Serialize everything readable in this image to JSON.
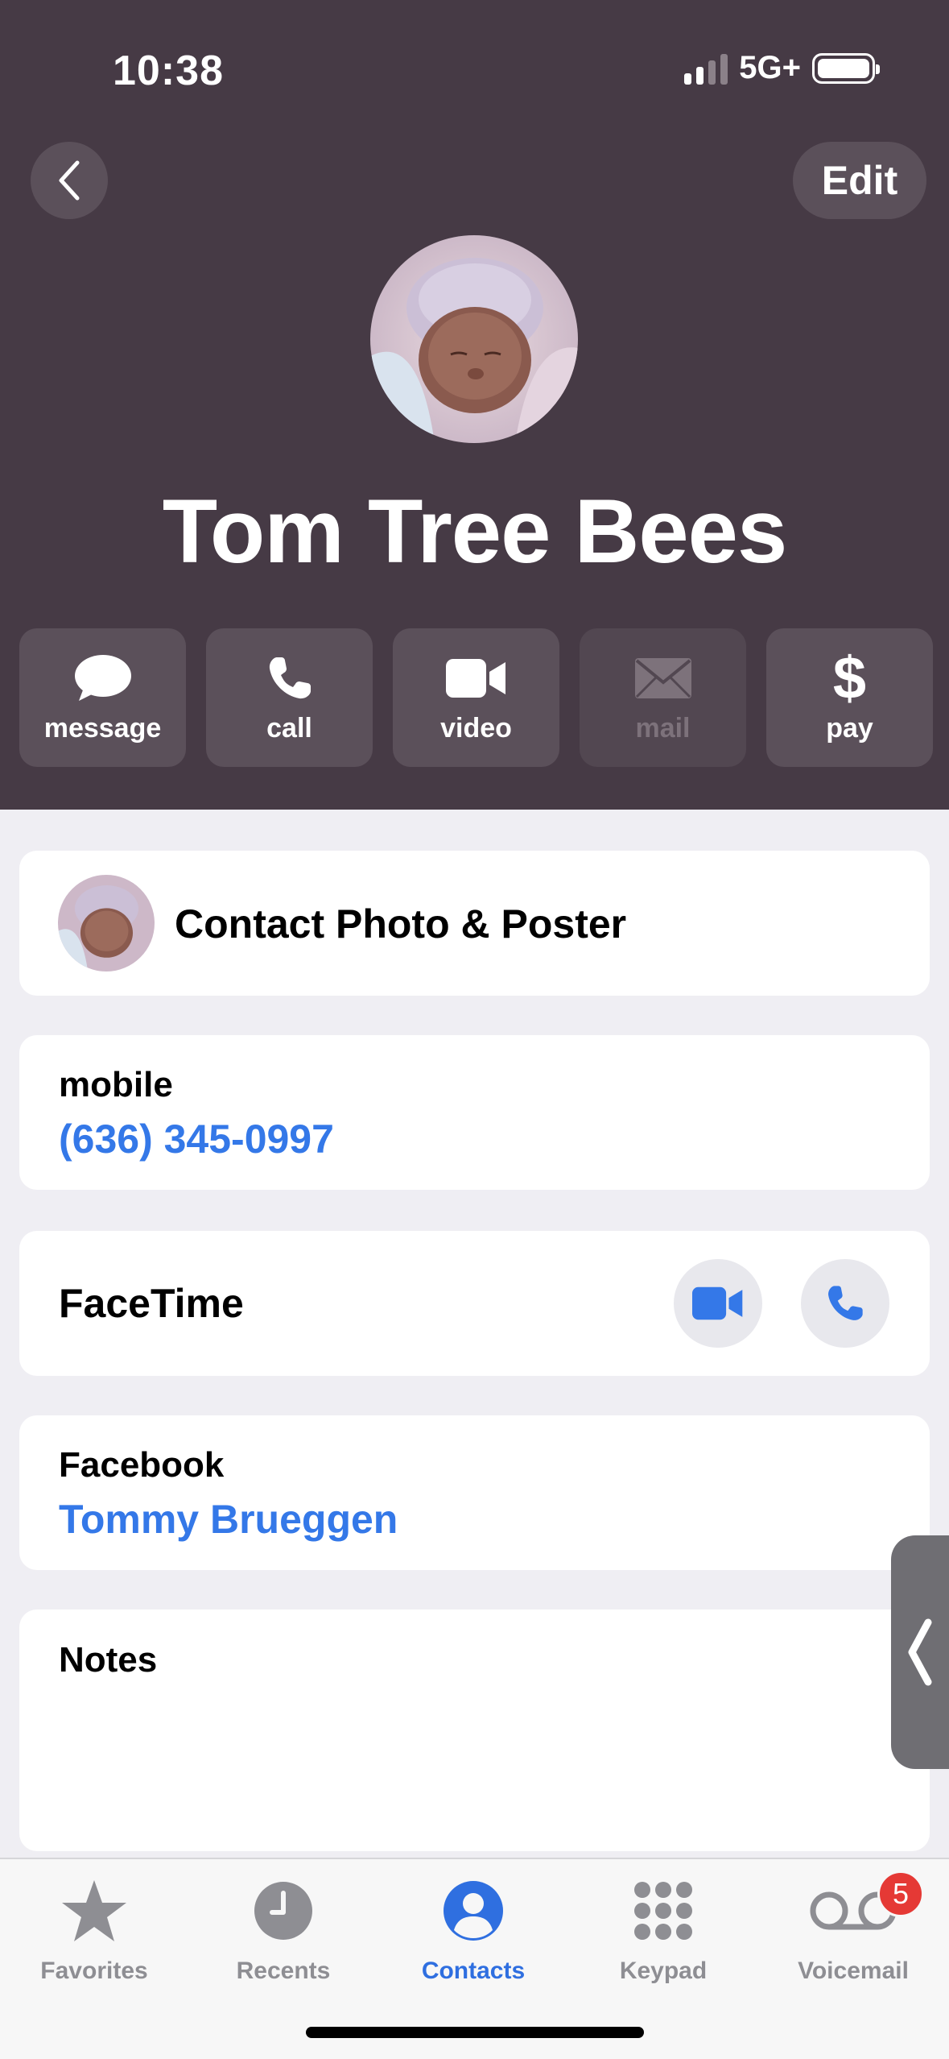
{
  "status_bar": {
    "time": "10:38",
    "network": "5G+"
  },
  "header": {
    "edit_label": "Edit",
    "contact_name": "Tom Tree Bees",
    "background_color": "#463a45"
  },
  "actions": [
    {
      "label": "message",
      "icon": "message-bubble-icon",
      "enabled": true
    },
    {
      "label": "call",
      "icon": "phone-icon",
      "enabled": true
    },
    {
      "label": "video",
      "icon": "video-camera-icon",
      "enabled": true
    },
    {
      "label": "mail",
      "icon": "envelope-icon",
      "enabled": false
    },
    {
      "label": "pay",
      "icon": "dollar-icon",
      "enabled": true
    }
  ],
  "pay_symbol": "$",
  "poster": {
    "label": "Contact Photo & Poster"
  },
  "phone": {
    "label": "mobile",
    "number": "(636) 345-0997"
  },
  "facetime": {
    "label": "FaceTime"
  },
  "facebook": {
    "label": "Facebook",
    "value": "Tommy Brueggen"
  },
  "notes": {
    "label": "Notes",
    "value": ""
  },
  "tabbar": {
    "tabs": [
      {
        "label": "Favorites",
        "icon": "star-icon",
        "active": false
      },
      {
        "label": "Recents",
        "icon": "clock-icon",
        "active": false
      },
      {
        "label": "Contacts",
        "icon": "person-circle-icon",
        "active": true
      },
      {
        "label": "Keypad",
        "icon": "keypad-icon",
        "active": false
      },
      {
        "label": "Voicemail",
        "icon": "voicemail-icon",
        "active": false
      }
    ],
    "voicemail_badge": "5"
  },
  "colors": {
    "accent": "#3478e8",
    "badge": "#e53935"
  }
}
